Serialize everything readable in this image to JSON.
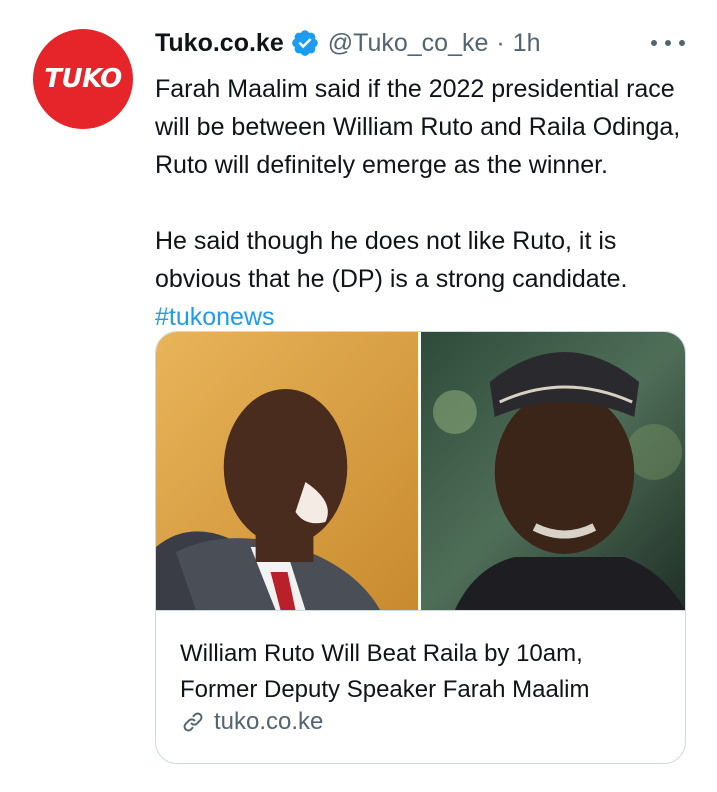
{
  "tweet": {
    "avatar": {
      "text": "TUKO",
      "icon": "tuko-logo",
      "color": "#e5252a"
    },
    "display_name": "Tuko.co.ke",
    "verified_icon": "verified-badge-icon",
    "handle": "@Tuko_co_ke",
    "separator": "·",
    "time": "1h",
    "more_icon": "more-options-icon",
    "text_lines_1": [
      "Farah Maalim said if the 2022 presidential race",
      "will be between William Ruto and Raila Odinga,",
      "Ruto will definitely emerge as the winner."
    ],
    "text_lines_2": [
      "He said though he does not like Ruto, it is",
      "obvious that he (DP) is a strong candidate."
    ],
    "hashtag": "#tukonews",
    "card": {
      "image": "photo-of-william-ruto-and-raila-odinga",
      "title_lines": [
        "William Ruto Will Beat Raila by 10am,",
        "Former Deputy Speaker Farah Maalim"
      ],
      "domain_icon": "link-icon",
      "domain": "tuko.co.ke"
    }
  },
  "colors": {
    "text": "#0f1419",
    "secondary": "#536471",
    "link": "#1d9bf0",
    "border": "#cfd9de",
    "brand": "#e5252a"
  }
}
